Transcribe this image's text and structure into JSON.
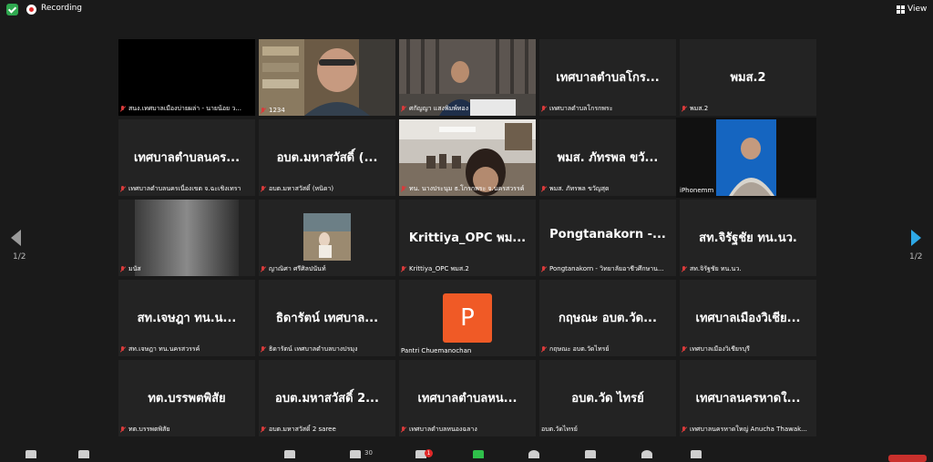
{
  "topbar": {
    "recording_label": "Recording",
    "view_label": "View"
  },
  "pager": {
    "left": "1/2",
    "right": "1/2"
  },
  "tiles": [
    {
      "name": "",
      "label": "สนง.เทศบาลเมืองบ่ายผล่า - นายน้อย ว..."
    },
    {
      "name": "",
      "label": "1234"
    },
    {
      "name": "",
      "label": "ศกัญญา แสงพิมพ์ทอง"
    },
    {
      "name": "เทศบาลตำบลโกร...",
      "label": "เทศบาลตำบลโกรกพระ"
    },
    {
      "name": "พมส.2",
      "label": "พมส.2"
    },
    {
      "name": "เทศบาลตำบลนคร...",
      "label": "เทศบาลตำบลนครเนื่องเขต จ.ฉะเชิงเทรา"
    },
    {
      "name": "อบต.มหาสวัสดิ์ (...",
      "label": "อบต.มหาสวัสดิ์ (หนิดา)"
    },
    {
      "name": "",
      "label": "ทน. นางประนุม ธ.โกรกพระ จ.นครสวรรค์"
    },
    {
      "name": "พมส. ภัทรพล ขวั...",
      "label": "พมส. ภัทรพล ขวัญสุด"
    },
    {
      "name": "",
      "label": "iPhonemm"
    },
    {
      "name": "",
      "label": "มนัส"
    },
    {
      "name": "",
      "label": "ญาณิศา ศรีศิลปนันท์"
    },
    {
      "name": "Krittiya_OPC พม...",
      "label": "Krittiya_OPC พมส.2"
    },
    {
      "name": "Pongtanakorn -...",
      "label": "Pongtanakorn - วิทยาลัยอาชีวศึกษาน..."
    },
    {
      "name": "สท.จิรัฐชัย ทน.นว.",
      "label": "สท.จิรัฐชัย ทน.นว."
    },
    {
      "name": "สท.เจษฎา ทน.น...",
      "label": "สท.เจษฎา ทน.นครสวรรค์"
    },
    {
      "name": "ธิดารัตน์ เทศบาล...",
      "label": "ธิดารัตน์ เทศบาลตำบลบางปรมุง"
    },
    {
      "name": "",
      "label": "Pantri Chuemanochan",
      "avatar": "P"
    },
    {
      "name": "กฤษณะ อบต.วัด...",
      "label": "กฤษณะ อบต.วัดไทรย์"
    },
    {
      "name": "เทศบาลเมืองวิเชีย...",
      "label": "เทศบาลเมืองวิเชียรบุรี"
    },
    {
      "name": "ทต.บรรพตพิสัย",
      "label": "ทต.บรรพตพิสัย"
    },
    {
      "name": "อบต.มหาสวัสดิ์ 2...",
      "label": "อบต.มหาสวัสดิ์ 2 saree"
    },
    {
      "name": "เทศบาลตำบลหน...",
      "label": "เทศบาลตำบลหนองฉลาง"
    },
    {
      "name": "อบต.วัด ไทรย์",
      "label": "อบต.วัดไทรย์"
    },
    {
      "name": "เทศบาลนครหาดใ...",
      "label": "เทศบาลนครหาดใหญ่ Anucha Thawak..."
    }
  ],
  "toolbar": {
    "participants_count": "30",
    "chat_badge": "1"
  },
  "colors": {
    "tile_bg": "#232323",
    "active_border": "#e6ea6a",
    "muted_red": "#d83b3b",
    "avatar_orange": "#f05a26"
  }
}
